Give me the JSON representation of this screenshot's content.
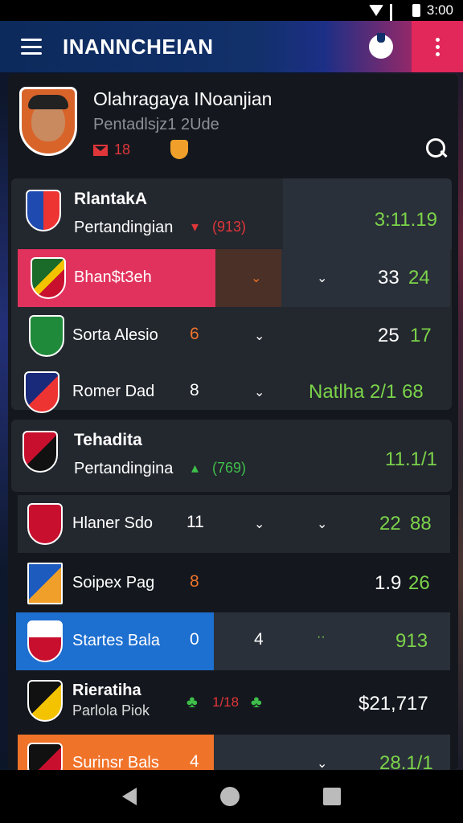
{
  "status": {
    "time": "3:00"
  },
  "app_bar": {
    "title": "INANNCHEIAN"
  },
  "header": {
    "title": "Olahragaya INoanjian",
    "subtitle": "Pentadlsjz1 2Ude",
    "count": "18"
  },
  "groups": [
    {
      "title": "RlantakA",
      "subtitle": "Pertandingian",
      "trend": "(913)",
      "score": "3:11.19"
    },
    {
      "title": "Tehadita",
      "subtitle": "Pertandingina",
      "trend": "(769)",
      "score": "11.1/1"
    }
  ],
  "rows": [
    {
      "name": "Bhan$t3eh",
      "num": "",
      "score_a": "33",
      "score_b": "24"
    },
    {
      "name": "Sorta Alesio",
      "num": "6",
      "score_a": "25",
      "score_b": "17"
    },
    {
      "name": "Romer Dad",
      "num": "8",
      "score_a": "",
      "score_b": "Natlha 2/1 68"
    },
    {
      "name": "Hlaner Sdo",
      "num": "11",
      "score_a": "22",
      "score_b": "88"
    },
    {
      "name": "Soipex Pag",
      "num": "8",
      "score_a": "1.9",
      "score_b": "26"
    },
    {
      "name": "Startes Bala",
      "num": "0",
      "extra": "4",
      "score_a": "",
      "score_b": "913"
    },
    {
      "name": "Rieratiha",
      "sub": "Parlola Piok",
      "num": "1/18",
      "score_a": "$21,717",
      "score_b": ""
    },
    {
      "name": "Surinsr Bals",
      "num": "4",
      "score_a": "",
      "score_b": "28.1/1"
    }
  ],
  "colors": {
    "accent_red": "#e2275a",
    "accent_blue": "#1d6fd0",
    "accent_orange": "#f0732a",
    "score_green": "#7bd34a"
  }
}
